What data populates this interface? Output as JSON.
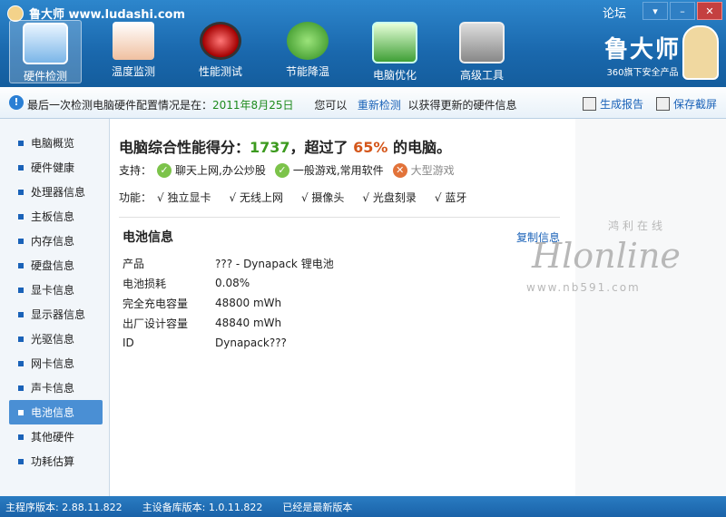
{
  "app": {
    "title": "鲁大师 www.ludashi.com",
    "forum": "论坛"
  },
  "toolbar": [
    {
      "label": "硬件检测",
      "icon": "computer-magnifier-icon"
    },
    {
      "label": "温度监测",
      "icon": "thermometer-icon"
    },
    {
      "label": "性能测试",
      "icon": "gauge-icon"
    },
    {
      "label": "节能降温",
      "icon": "clover-fan-icon"
    },
    {
      "label": "电脑优化",
      "icon": "monitor-broom-icon"
    },
    {
      "label": "高级工具",
      "icon": "toolbox-icon"
    }
  ],
  "brand": {
    "logo": "鲁大师",
    "slogan": "360旗下安全产品"
  },
  "infobar": {
    "prefix": "最后一次检测电脑硬件配置情况是在：",
    "date": "2011年8月25日",
    "mid": "您可以",
    "link": "重新检测",
    "suffix": "以获得更新的硬件信息",
    "report": "生成报告",
    "screenshot": "保存截屏"
  },
  "sidebar": {
    "items": [
      "电脑概览",
      "硬件健康",
      "处理器信息",
      "主板信息",
      "内存信息",
      "硬盘信息",
      "显卡信息",
      "显示器信息",
      "光驱信息",
      "网卡信息",
      "声卡信息",
      "电池信息",
      "其他硬件",
      "功耗估算"
    ],
    "active_index": 11
  },
  "main": {
    "score_prefix": "电脑综合性能得分：",
    "score": "1737",
    "score_mid": "，超过了",
    "percent": "65%",
    "score_suffix": " 的电脑。",
    "support_label": "支持：",
    "support": [
      {
        "label": "聊天上网,办公炒股",
        "ok": true
      },
      {
        "label": "一般游戏,常用软件",
        "ok": true
      },
      {
        "label": "大型游戏",
        "ok": false
      }
    ],
    "features_label": "功能：",
    "features": [
      "√ 独立显卡",
      "√ 无线上网",
      "√ 摄像头",
      "√ 光盘刻录",
      "√ 蓝牙"
    ],
    "section_title": "电池信息",
    "copy": "复制信息",
    "battery": [
      {
        "k": "产品",
        "v": "??? - Dynapack 锂电池"
      },
      {
        "k": "电池损耗",
        "v": "0.08%"
      },
      {
        "k": "完全充电容量",
        "v": "48800 mWh"
      },
      {
        "k": "出厂设计容量",
        "v": "48840 mWh"
      },
      {
        "k": "ID",
        "v": "Dynapack???"
      }
    ]
  },
  "watermark": {
    "cn": "鸿利在线",
    "en": "Hlonline",
    "url": "www.nb591.com"
  },
  "status": {
    "main_ver": "主程序版本: 2.88.11.822",
    "db_ver": "主设备库版本: 1.0.11.822",
    "state": "已经是最新版本"
  }
}
